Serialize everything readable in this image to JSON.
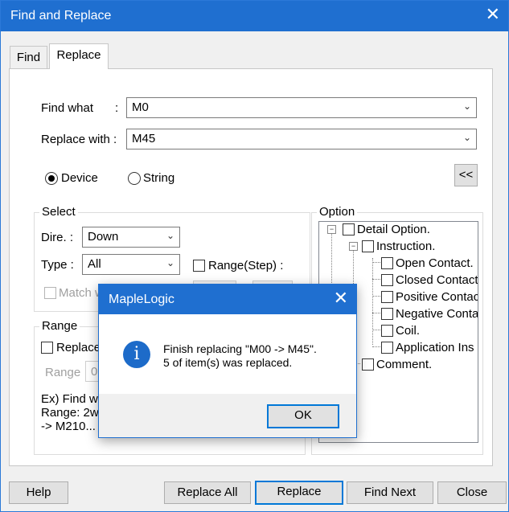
{
  "window": {
    "title": "Find and Replace",
    "close_glyph": "✕"
  },
  "tabs": [
    {
      "label": "Find"
    },
    {
      "label": "Replace"
    }
  ],
  "find_what": {
    "label": "Find what",
    "colon": ":",
    "value": "M0"
  },
  "replace_with": {
    "label": "Replace with :",
    "value": "M45"
  },
  "search_type": {
    "device_label": "Device",
    "string_label": "String",
    "selected": "Device"
  },
  "collapse_button": {
    "label": "<<"
  },
  "select_group": {
    "title": "Select",
    "direction": {
      "label": "Dire. :",
      "value": "Down"
    },
    "type": {
      "label": "Type :",
      "value": "All"
    },
    "range_step_label": "Range(Step) :",
    "match_label": "Match w"
  },
  "range_group": {
    "title": "Range",
    "replace_label": "Replace",
    "range_label": "Range",
    "range_value": "0",
    "example_line1": "Ex) Find w",
    "example_line2": "Range: 2w",
    "example_line3": "-> M210..."
  },
  "option_group": {
    "title": "Option",
    "items": {
      "detail": "Detail Option.",
      "instruction": "Instruction.",
      "open_contact": "Open Contact.",
      "closed_contact": "Closed Contact",
      "positive_contact": "Positive Contac",
      "negative_contact": "Negative Conta",
      "coil": "Coil.",
      "application": "Application Ins",
      "comment": "Comment."
    }
  },
  "footer": {
    "help": "Help",
    "replace_all": "Replace All",
    "replace": "Replace",
    "find_next": "Find Next",
    "close": "Close"
  },
  "message_box": {
    "title": "MapleLogic",
    "icon": "info-icon",
    "line1": "Finish replacing \"M00 -> M45\".",
    "line2": "5 of item(s) was replaced.",
    "ok": "OK"
  },
  "colors": {
    "accent": "#1f6fd0",
    "background": "#f0f0f0",
    "focus": "#0078d7"
  }
}
